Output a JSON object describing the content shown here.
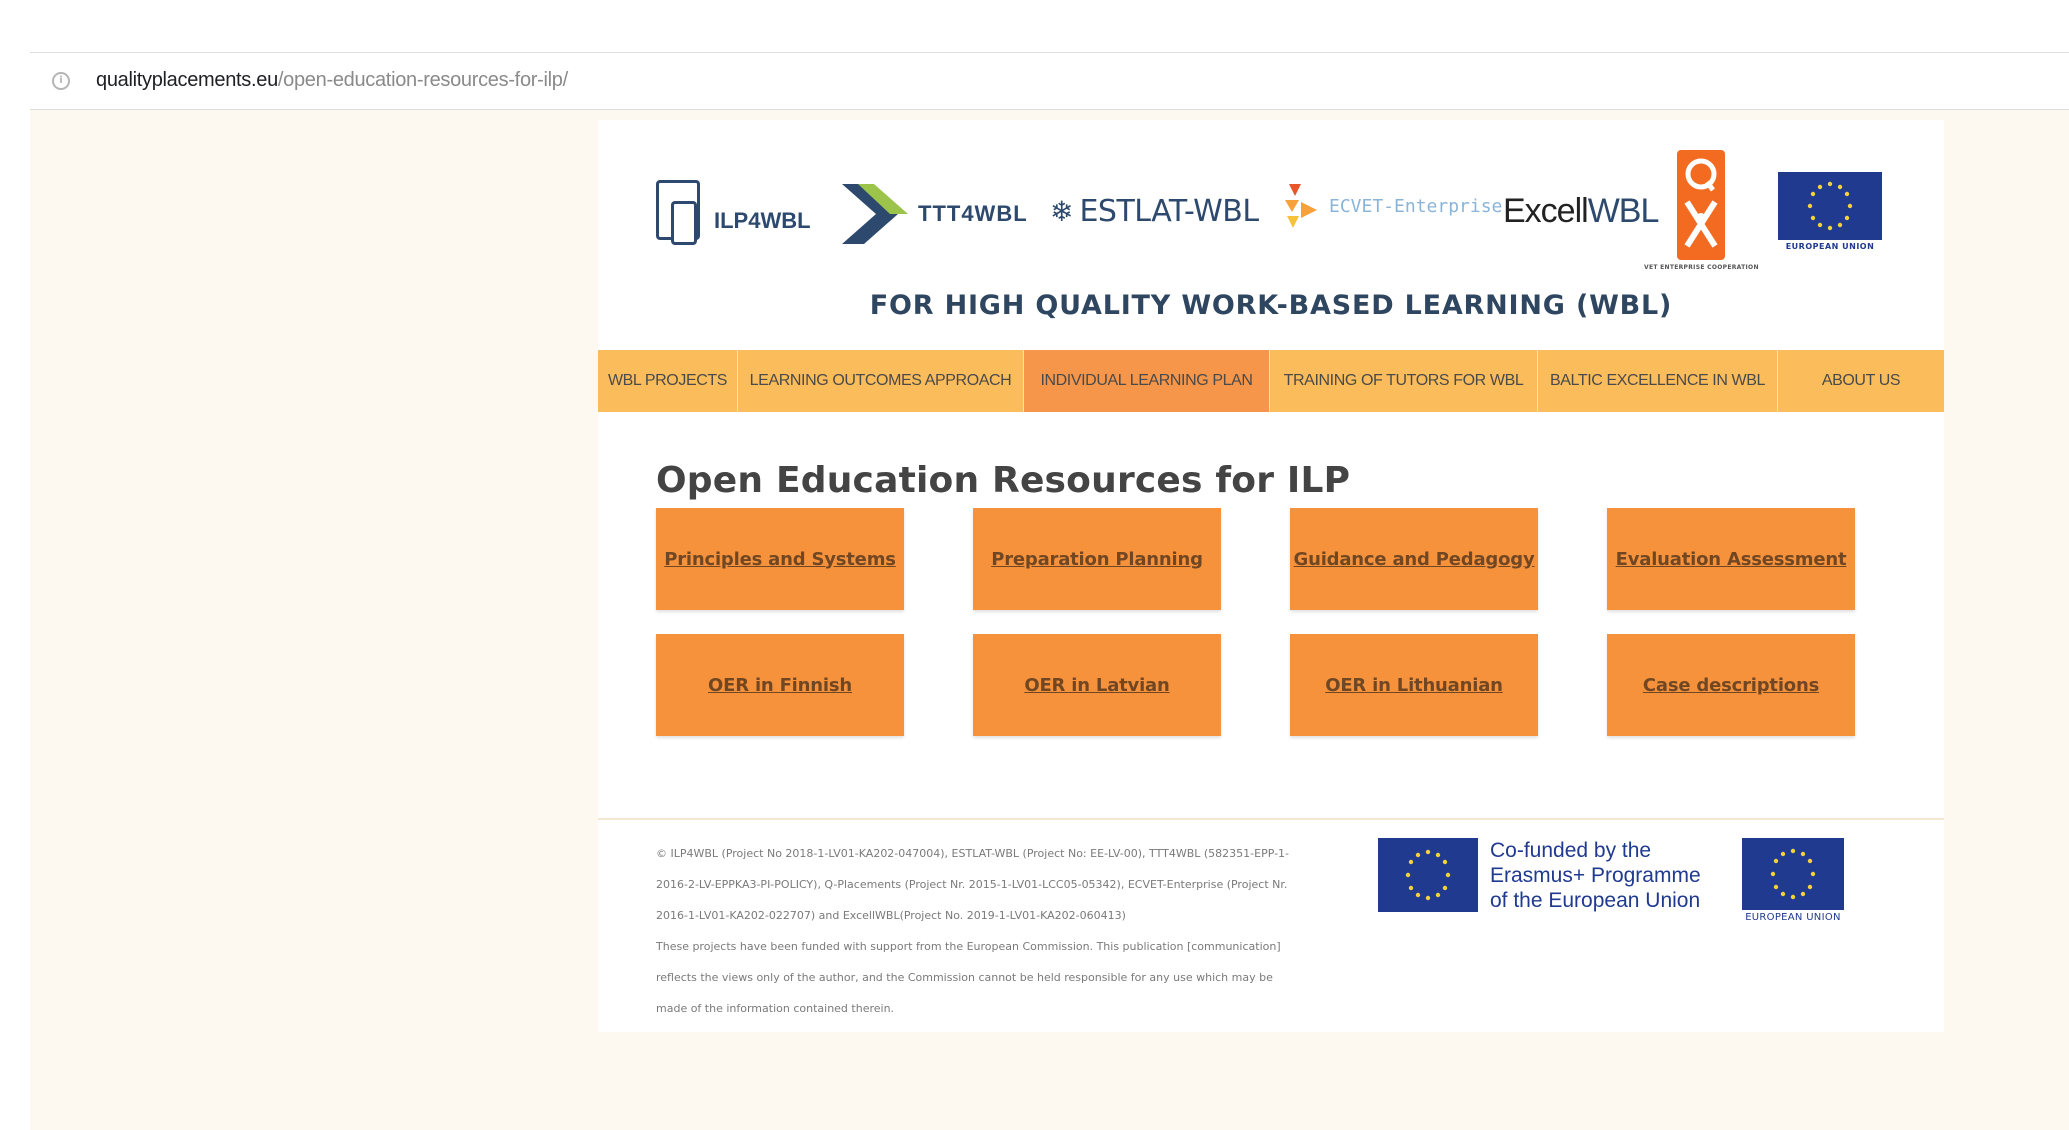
{
  "browser": {
    "url_domain": "qualityplacements.eu",
    "url_path": "/open-education-resources-for-ilp/"
  },
  "logos": {
    "ilp": "ILP4WBL",
    "ttt": "TTT4WBL",
    "estlat": "ESTLAT-WBL",
    "ecvet": "ECVET-Enterprise",
    "excell_prefix": "Excell",
    "excell_suffix": "WBL",
    "q_caption": "VET ENTERPRISE COOPERATION",
    "eu_caption": "EUROPEAN UNION"
  },
  "tagline": "FOR HIGH QUALITY WORK-BASED LEARNING (WBL)",
  "nav": [
    {
      "label": "WBL PROJECTS",
      "active": false
    },
    {
      "label": "LEARNING OUTCOMES APPROACH",
      "active": false
    },
    {
      "label": "INDIVIDUAL LEARNING PLAN",
      "active": true
    },
    {
      "label": "TRAINING OF TUTORS FOR WBL",
      "active": false
    },
    {
      "label": "BALTIC EXCELLENCE IN WBL",
      "active": false
    },
    {
      "label": "ABOUT US",
      "active": false
    }
  ],
  "page_title": "Open Education Resources for ILP",
  "tiles": [
    "Principles and Systems",
    "Preparation Planning",
    "Guidance and Pedagogy",
    "Evaluation Assessment",
    "OER in Finnish",
    "OER in Latvian",
    "OER in Lithuanian",
    "Case descriptions"
  ],
  "footer": {
    "line1": "© ILP4WBL (Project No 2018-1-LV01-KA202-047004), ESTLAT-WBL (Project No: EE-LV-00), TTT4WBL (582351-EPP-1-",
    "line2": "2016-2-LV-EPPKA3-PI-POLICY), Q-Placements (Project Nr. 2015-1-LV01-LCC05-05342), ECVET-Enterprise (Project Nr.",
    "line3": "2016-1-LV01-KA202-022707) and ExcellWBL(Project No. 2019-1-LV01-KA202-060413)",
    "line4": "These projects have been funded with support from the European Commission. This publication [communication]",
    "line5": "reflects the views only of the author, and the Commission cannot be held responsible for any use which may be",
    "line6": "made of the information contained therein.",
    "cofund_line1": "Co-funded by the",
    "cofund_line2": "Erasmus+ Programme",
    "cofund_line3": "of the European Union",
    "eu_caption": "EUROPEAN UNION"
  },
  "colors": {
    "nav_bg": "#fbbd5c",
    "nav_active": "#f6964a",
    "tile_bg": "#f6923c",
    "brand_blue": "#2d4a6e",
    "eu_blue": "#1f3a8f"
  }
}
